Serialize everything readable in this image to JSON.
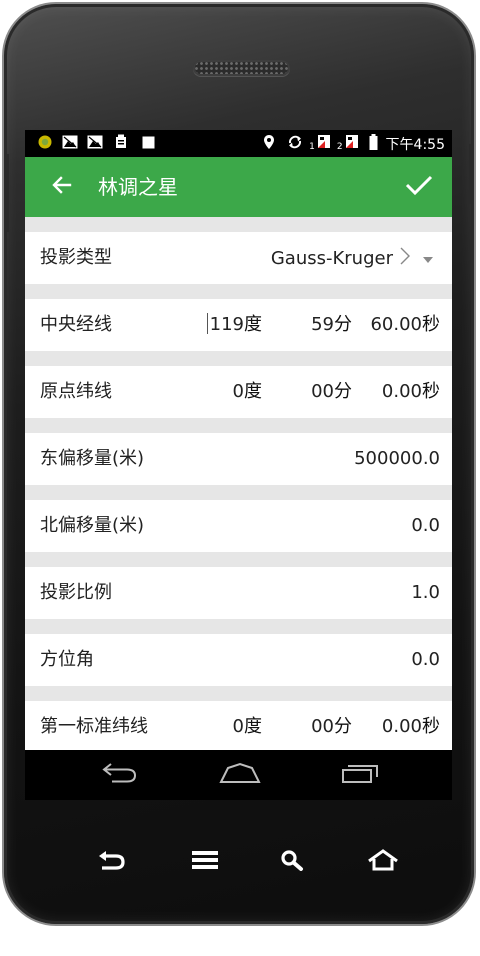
{
  "colors": {
    "accent": "#3ca849",
    "content_bg": "#e6e6e6",
    "row_bg": "#ffffff",
    "text": "#222222"
  },
  "status_bar": {
    "icons_left": [
      "app-notification-icon",
      "image-icon",
      "image-icon",
      "clipboard-icon",
      "square-icon"
    ],
    "icons_right": [
      "location-icon",
      "sync-icon",
      "sim-data-icon",
      "sim-data-icon",
      "battery-icon"
    ],
    "sim1": "1",
    "sim2": "2",
    "time": "下午4:55"
  },
  "app_bar": {
    "title": "林调之星",
    "back_icon": "arrow-left-icon",
    "confirm_icon": "check-icon"
  },
  "form": {
    "projection_type": {
      "label": "投影类型",
      "value": "Gauss-Kruger"
    },
    "central_meridian": {
      "label": "中央经线",
      "deg": "119",
      "deg_unit": "度",
      "min": "59",
      "min_unit": "分",
      "sec": "60.00",
      "sec_unit": "秒"
    },
    "origin_latitude": {
      "label": "原点纬线",
      "deg": "0",
      "deg_unit": "度",
      "min": "00",
      "min_unit": "分",
      "sec": "0.00",
      "sec_unit": "秒"
    },
    "false_easting": {
      "label": "东偏移量(米)",
      "value": "500000.0"
    },
    "false_northing": {
      "label": "北偏移量(米)",
      "value": "0.0"
    },
    "scale_factor": {
      "label": "投影比例",
      "value": "1.0"
    },
    "azimuth": {
      "label": "方位角",
      "value": "0.0"
    },
    "first_standard_parallel": {
      "label": "第一标准纬线",
      "deg": "0",
      "deg_unit": "度",
      "min": "00",
      "min_unit": "分",
      "sec": "0.00",
      "sec_unit": "秒"
    }
  },
  "system_nav": [
    "back-icon",
    "home-icon",
    "recents-icon"
  ],
  "hardware_buttons": [
    "back-icon",
    "menu-icon",
    "search-icon",
    "home-icon"
  ]
}
